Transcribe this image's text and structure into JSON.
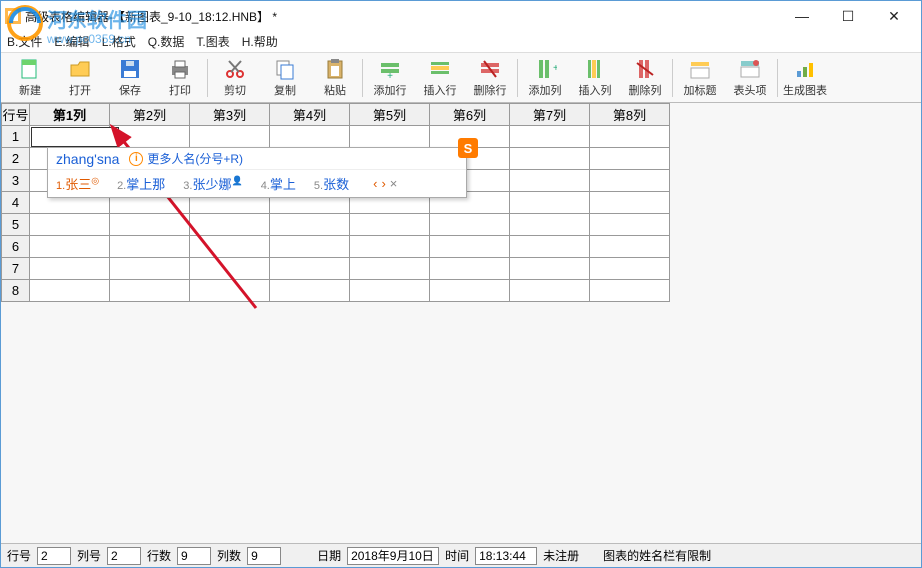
{
  "window": {
    "title": "高级表格编辑器-【新图表_9-10_18:12.HNB】 *"
  },
  "menus": {
    "file": "B.文件",
    "edit": "E.编辑",
    "format": "L.格式",
    "data": "Q.数据",
    "chart": "T.图表",
    "help": "H.帮助"
  },
  "toolbar": [
    {
      "id": "new",
      "label": "新建"
    },
    {
      "id": "open",
      "label": "打开"
    },
    {
      "id": "save",
      "label": "保存"
    },
    {
      "id": "print",
      "label": "打印"
    },
    {
      "sep": true
    },
    {
      "id": "cut",
      "label": "剪切"
    },
    {
      "id": "copy",
      "label": "复制"
    },
    {
      "id": "paste",
      "label": "粘贴"
    },
    {
      "sep": true
    },
    {
      "id": "addrow",
      "label": "添加行"
    },
    {
      "id": "insrow",
      "label": "插入行"
    },
    {
      "id": "delrow",
      "label": "删除行"
    },
    {
      "sep": true
    },
    {
      "id": "addcol",
      "label": "添加列"
    },
    {
      "id": "inscol",
      "label": "插入列"
    },
    {
      "id": "delcol",
      "label": "删除列"
    },
    {
      "sep": true
    },
    {
      "id": "addtitle",
      "label": "加标题"
    },
    {
      "id": "headopt",
      "label": "表头项"
    },
    {
      "sep": true
    },
    {
      "id": "genchart",
      "label": "生成图表"
    }
  ],
  "grid": {
    "corner": "行号",
    "cols": [
      "第1列",
      "第2列",
      "第3列",
      "第4列",
      "第5列",
      "第6列",
      "第7列",
      "第8列"
    ],
    "rows": [
      "1",
      "2",
      "3",
      "4",
      "5",
      "6",
      "7",
      "8"
    ],
    "active_col": 0
  },
  "ime": {
    "input": "zhang'sna",
    "more": "更多人名(分号+R)",
    "candidates": [
      {
        "n": "1",
        "text": "张三",
        "sel": true,
        "badge": "◎"
      },
      {
        "n": "2",
        "text": "掌上那"
      },
      {
        "n": "3",
        "text": "张少娜",
        "badge": "👤"
      },
      {
        "n": "4",
        "text": "掌上"
      },
      {
        "n": "5",
        "text": "张数"
      }
    ],
    "nav_prev": "‹",
    "nav_next": "›",
    "nav_close": "×",
    "brand": "S"
  },
  "status": {
    "row_label": "行号",
    "row_val": "2",
    "col_label": "列号",
    "col_val": "2",
    "rows_label": "行数",
    "rows_val": "9",
    "cols_label": "列数",
    "cols_val": "9",
    "date_label": "日期",
    "date_val": "2018年9月10日",
    "time_label": "时间",
    "time_val": "18:13:44",
    "reg": "未注册",
    "hint": "图表的姓名栏有限制"
  },
  "watermark": {
    "text": "河东软件园",
    "url": "www.pc0359.cn"
  }
}
